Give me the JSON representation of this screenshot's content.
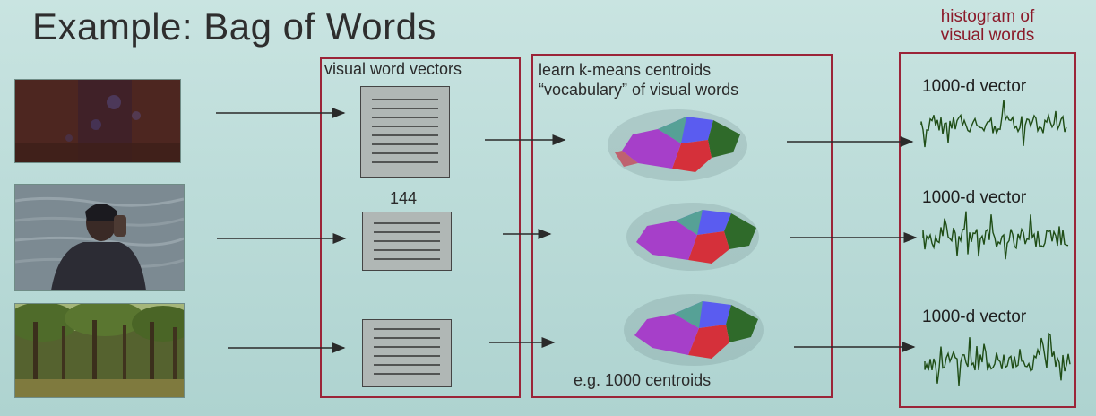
{
  "slide": {
    "title": "Example: Bag of Words"
  },
  "histogram_header": {
    "line1": "histogram of",
    "line2": "visual words"
  },
  "vectors_panel": {
    "label": "visual word vectors",
    "count": "144"
  },
  "kmeans_panel": {
    "line1": "learn k-means centroids",
    "line2": "“vocabulary” of visual words",
    "footer": "e.g. 1000 centroids"
  },
  "histogram_panel": {
    "vector_labels": [
      "1000-d vector",
      "1000-d vector",
      "1000-d vector"
    ]
  },
  "colors": {
    "border": "#9b2438",
    "title": "#2e2e2e",
    "header": "#8b1a2a",
    "histogram": "#1f4d16"
  }
}
